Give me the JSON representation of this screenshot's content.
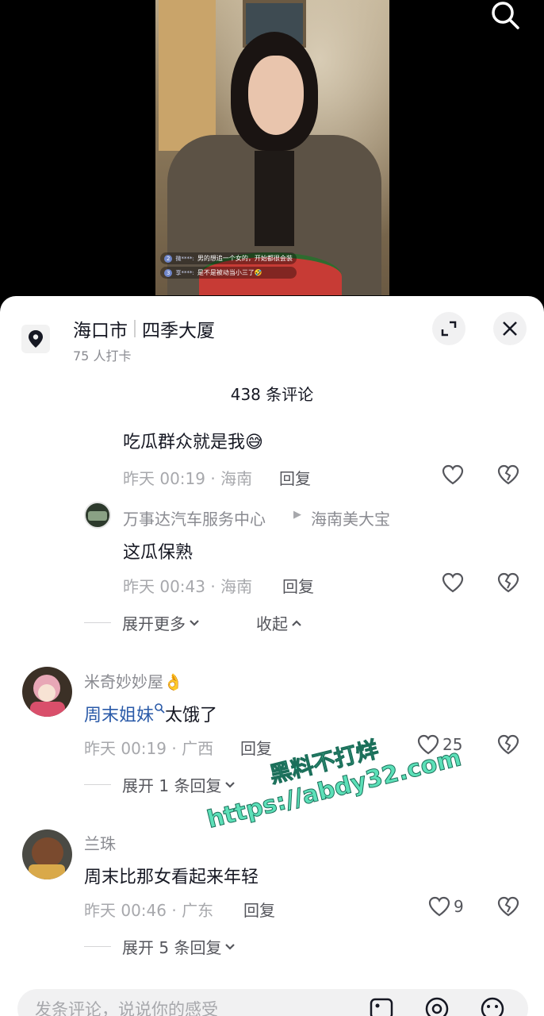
{
  "video": {
    "live_comments": [
      {
        "badge": "2",
        "user": "微****:",
        "text": "男的想追一个女的，开始都很会装"
      },
      {
        "badge": "3",
        "user": "享****:",
        "text": "是不是被动当小三了🤣"
      }
    ]
  },
  "location": {
    "city": "海口市",
    "place": "四季大厦",
    "checkins": "75 人打卡"
  },
  "comment_count": "438 条评论",
  "comments": {
    "c1": {
      "text": "吃瓜群众就是我😅",
      "time": "昨天 00:19 · 海南",
      "reply": "回复"
    },
    "c2": {
      "author": "万事达汽车服务中心",
      "reply_to": "海南美大宝",
      "text": "这瓜保熟",
      "time": "昨天 00:43 · 海南",
      "reply": "回复"
    },
    "thread1_expand": "展开更多",
    "thread1_collapse": "收起",
    "c3": {
      "author": "米奇妙妙屋👌",
      "mention": "周末姐妹",
      "text": "太饿了",
      "time": "昨天 00:19 · 广西",
      "reply": "回复",
      "likes": "25",
      "expand": "展开 1 条回复"
    },
    "c4": {
      "author": "兰珠",
      "text": "周末比那女看起来年轻",
      "time": "昨天 00:46 · 广东",
      "reply": "回复",
      "likes": "9",
      "expand": "展开 5 条回复"
    }
  },
  "watermark": {
    "line1": "黑料不打烊",
    "line2": "https://abdy32.com"
  },
  "input": {
    "placeholder": "发条评论，说说你的感受"
  },
  "colors": {
    "sheet_bg": "#ffffff",
    "mention": "#2a5aa8",
    "watermark": "#5ce0b8"
  }
}
